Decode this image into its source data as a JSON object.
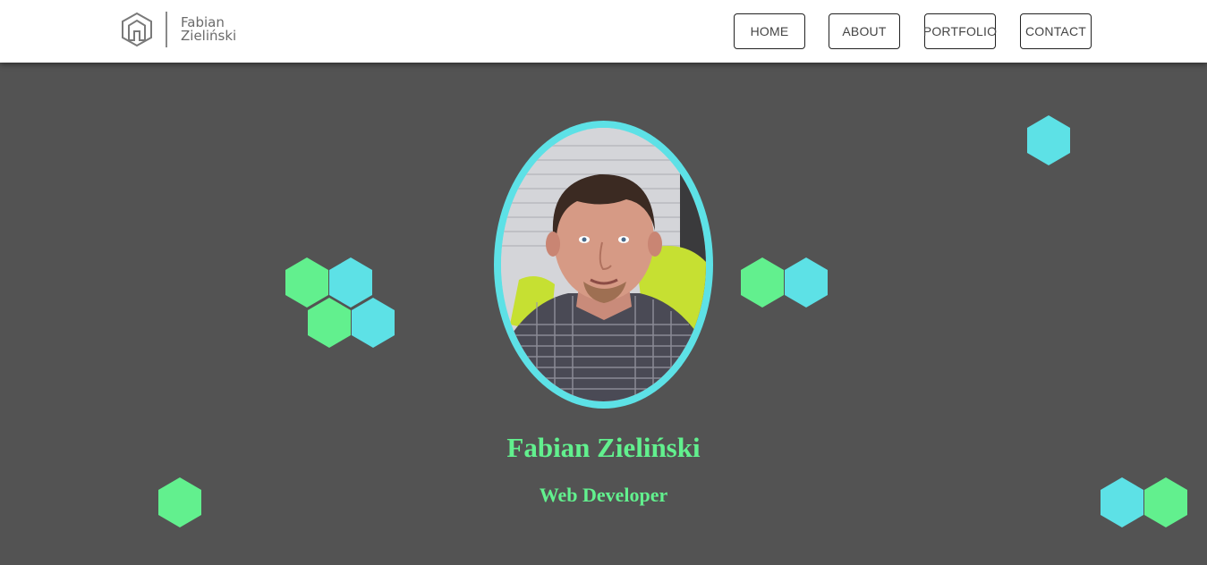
{
  "header": {
    "logo": {
      "first_name": "Fabian",
      "last_name": "Zieliński"
    },
    "nav": [
      {
        "label": "HOME"
      },
      {
        "label": "ABOUT"
      },
      {
        "label": "PORTFOLIO"
      },
      {
        "label": "CONTACT"
      }
    ]
  },
  "hero": {
    "name": "Fabian Zieliński",
    "role": "Web Developer"
  },
  "colors": {
    "background": "#535353",
    "accent_cyan": "#5de1e6",
    "accent_green": "#62f08e",
    "header_bg": "#ffffff"
  }
}
